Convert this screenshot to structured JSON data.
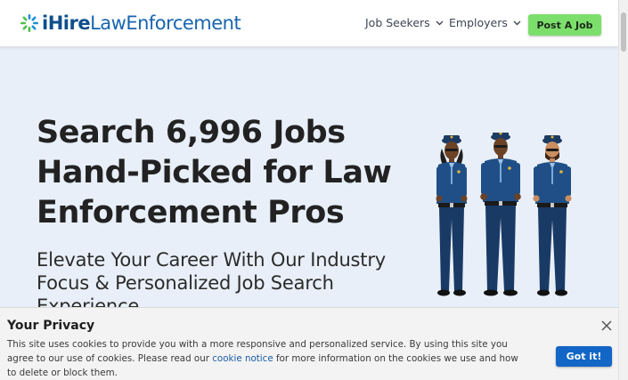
{
  "header": {
    "logo_brand": "iHire",
    "logo_sub": "LawEnforcement",
    "nav": {
      "job_seekers": "Job Seekers",
      "employers": "Employers"
    },
    "post_job_label": "Post A Job"
  },
  "hero": {
    "title": "Search 6,996 Jobs Hand-Picked for Law Enforcement Pros",
    "subtitle": "Elevate Your Career With Our Industry Focus & Personalized Job Search Experience"
  },
  "privacy": {
    "title": "Your Privacy",
    "text_before_link": "This site uses cookies to provide you with a more responsive and personalized service. By using this site you agree to our use of cookies. Please read our ",
    "link_text": "cookie notice",
    "text_after_link": " for more information on the cookies we use and how to delete or block them.",
    "accept_label": "Got it!"
  },
  "icons": {
    "logo": "starburst-logo-icon",
    "dropdown": "chevron-down-icon",
    "close": "close-icon"
  },
  "colors": {
    "brand_dark": "#0d4f8b",
    "brand_light": "#1765b0",
    "post_job_green": "#7cdf6b",
    "hero_background": "#e8eff8",
    "accept_button": "#1266c6"
  }
}
